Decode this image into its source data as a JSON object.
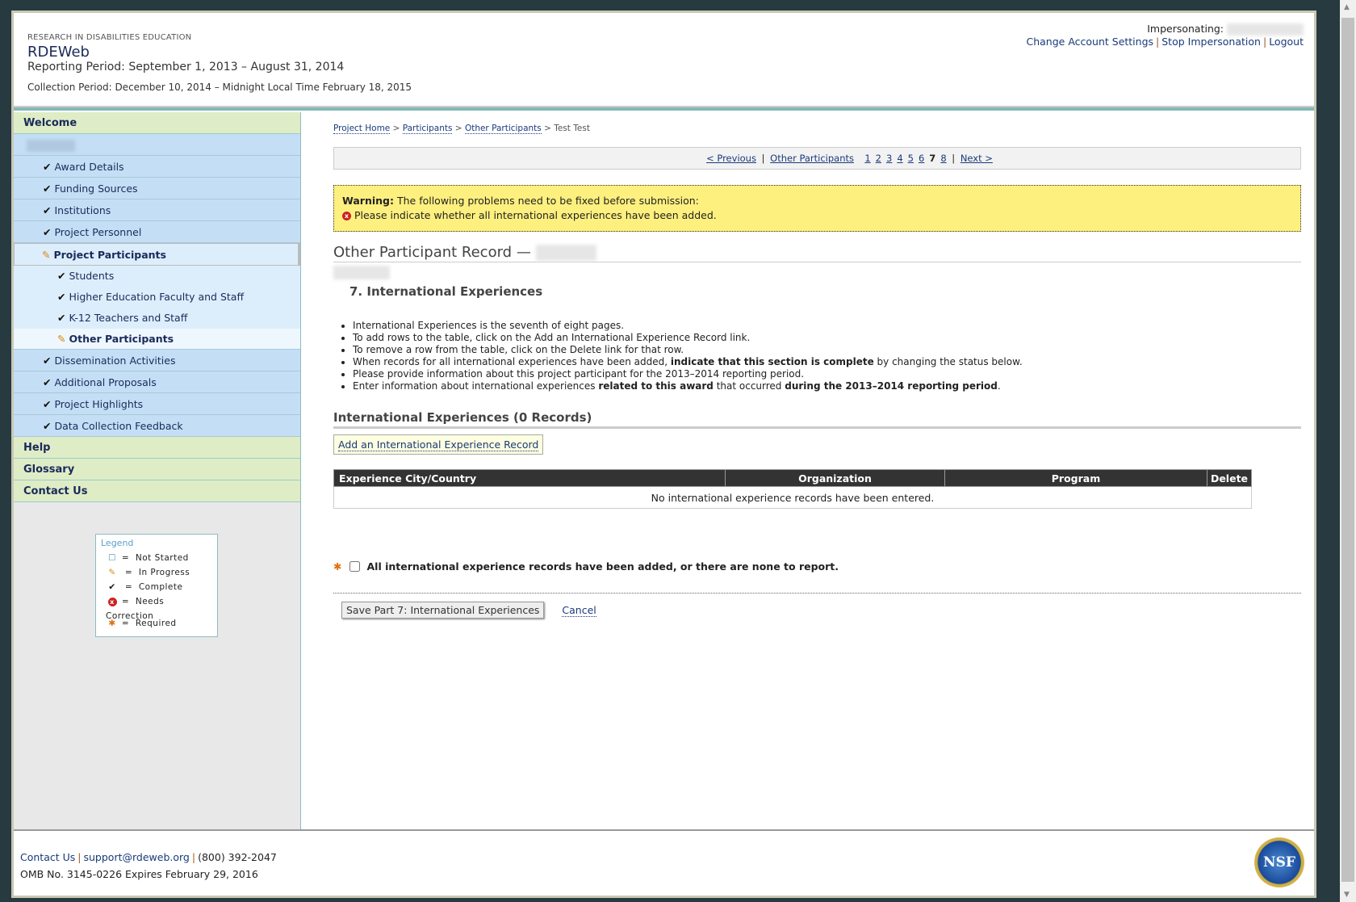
{
  "header": {
    "org": "RESEARCH IN DISABILITIES EDUCATION",
    "app": "RDEWeb",
    "reporting_period": "Reporting Period: September 1, 2013 – August 31, 2014",
    "collection_period": "Collection Period: December 10, 2014 – Midnight Local Time February 18, 2015",
    "impersonating_label": "Impersonating:",
    "links": [
      "Change Account Settings",
      "Stop Impersonation",
      "Logout"
    ]
  },
  "sidebar": {
    "welcome": "Welcome",
    "items": [
      "Award Details",
      "Funding Sources",
      "Institutions",
      "Project Personnel"
    ],
    "participants": "Project Participants",
    "sub": [
      "Students",
      "Higher Education Faculty and Staff",
      "K-12 Teachers and Staff"
    ],
    "current": "Other Participants",
    "items2": [
      "Dissemination Activities",
      "Additional Proposals",
      "Project Highlights",
      "Data Collection Feedback"
    ],
    "help": "Help",
    "glossary": "Glossary",
    "contact": "Contact Us"
  },
  "legend": {
    "title": "Legend",
    "items": [
      "Not Started",
      "In Progress",
      "Complete",
      "Needs Correction",
      "Required"
    ],
    "eq": "="
  },
  "breadcrumb": [
    "Project Home",
    "Participants",
    "Other Participants",
    "Test Test"
  ],
  "pager": {
    "prev": "< Previous",
    "section": "Other Participants",
    "pages": [
      "1",
      "2",
      "3",
      "4",
      "5",
      "6",
      "7",
      "8"
    ],
    "current": "7",
    "next": "Next >"
  },
  "warning": {
    "label": "Warning:",
    "text": "The following problems need to be fixed before submission:",
    "item": "Please indicate whether all international experiences have been added."
  },
  "record_title": "Other Participant Record —",
  "section_title": "7. International Experiences",
  "instructions": {
    "i1": "International Experiences is the seventh of eight pages.",
    "i2": "To add rows to the table, click on the Add an International Experience Record link.",
    "i3": "To remove a row from the table, click on the Delete link for that row.",
    "i4a": "When records for all international experiences have been added, ",
    "i4b": "indicate that this section is complete",
    "i4c": " by changing the status below.",
    "i5": "Please provide information about this project participant for the 2013–2014 reporting period.",
    "i6a": "Enter information about international experiences ",
    "i6b": "related to this award",
    "i6c": " that occurred ",
    "i6d": "during the 2013–2014 reporting period",
    "i6e": "."
  },
  "table_title": "International Experiences (0 Records)",
  "add_button": "Add an International Experience Record",
  "table": {
    "columns": [
      "Experience City/Country",
      "Organization",
      "Program",
      "Delete"
    ],
    "empty": "No international experience records have been entered."
  },
  "confirm_label": "All international experience records have been added, or there are none to report.",
  "save_button": "Save Part 7: International Experiences",
  "cancel": "Cancel",
  "footer": {
    "contact": "Contact Us",
    "email": "support@rdeweb.org",
    "phone": "(800) 392-2047",
    "omb": "OMB No. 3145-0226 Expires February 29, 2016",
    "logo": "NSF"
  }
}
